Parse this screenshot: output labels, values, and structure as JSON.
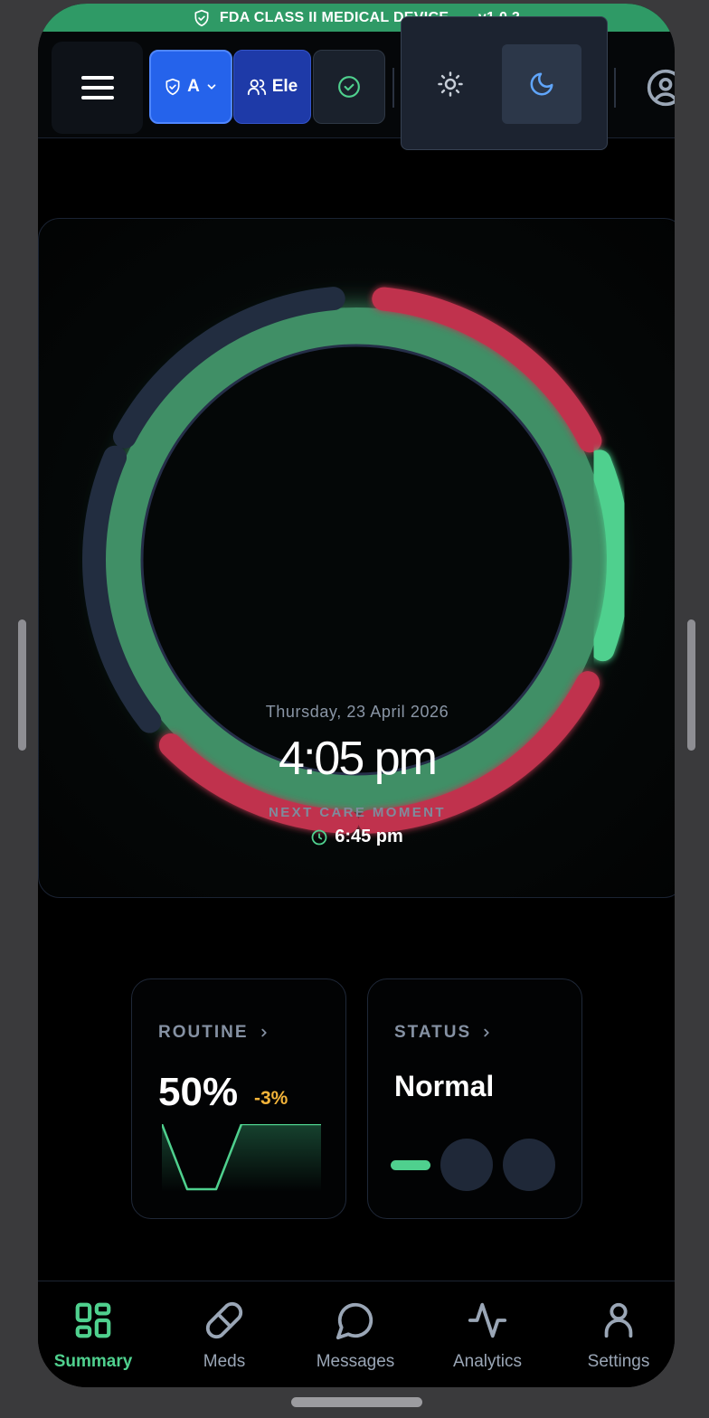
{
  "banner": {
    "label": "FDA CLASS II MEDICAL DEVICE",
    "separator": "•",
    "version": "v1.0.2"
  },
  "header": {
    "access_label": "A",
    "users_label": "Ele",
    "theme_options": [
      {
        "name": "sun-icon",
        "selected": false
      },
      {
        "name": "moon-icon",
        "selected": true
      }
    ]
  },
  "dial": {
    "date": "Thursday, 23 April 2026",
    "time": "4:05 pm",
    "next_label": "NEXT CARE MOMENT",
    "next_time": "6:45 pm"
  },
  "cards": {
    "routine": {
      "title": "ROUTINE",
      "value": "50%",
      "delta": "-3%"
    },
    "status": {
      "title": "STATUS",
      "value": "Normal"
    }
  },
  "nav": {
    "items": [
      {
        "label": "Summary",
        "icon": "grid-icon",
        "active": true
      },
      {
        "label": "Meds",
        "icon": "pill-icon",
        "active": false
      },
      {
        "label": "Messages",
        "icon": "chat-bubble-icon",
        "active": false
      },
      {
        "label": "Analytics",
        "icon": "pulse-icon",
        "active": false
      },
      {
        "label": "Settings",
        "icon": "user-icon",
        "active": false
      }
    ]
  },
  "colors": {
    "accent_green": "#4fd08e",
    "alert_red": "#c0334d",
    "primary_blue": "#2563eb",
    "warning_amber": "#f3b43a"
  }
}
